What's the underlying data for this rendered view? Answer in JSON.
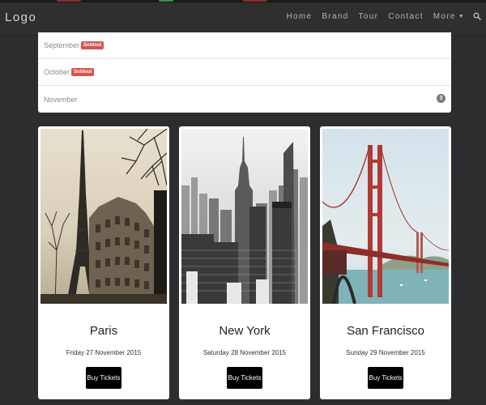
{
  "navbar": {
    "logo": "Logo",
    "items": [
      {
        "label": "Home"
      },
      {
        "label": "Brand"
      },
      {
        "label": "Tour"
      },
      {
        "label": "Contact"
      },
      {
        "label": "More"
      }
    ],
    "accent_colors": [
      "#d9534f",
      "#5cb85c"
    ]
  },
  "months": [
    {
      "name": "September",
      "badge": "Soldout"
    },
    {
      "name": "October",
      "badge": "Soldout"
    },
    {
      "name": "November",
      "count": "3"
    }
  ],
  "cards": [
    {
      "city": "Paris",
      "date": "Friday 27 November 2015",
      "button": "Buy Tickets",
      "photo": "eiffel-tower-photo"
    },
    {
      "city": "New York",
      "date": "Saturday 28 November 2015",
      "button": "Buy Tickets",
      "photo": "new-york-skyline-photo"
    },
    {
      "city": "San Francisco",
      "date": "Sunday 29 November 2015",
      "button": "Buy Tickets",
      "photo": "golden-gate-bridge-photo"
    }
  ],
  "colors": {
    "page_bg": "#2d2d30",
    "navbar_bg": "#2f2f2f",
    "soldout": "#d9534f",
    "badge": "#777777",
    "button": "#000000"
  }
}
